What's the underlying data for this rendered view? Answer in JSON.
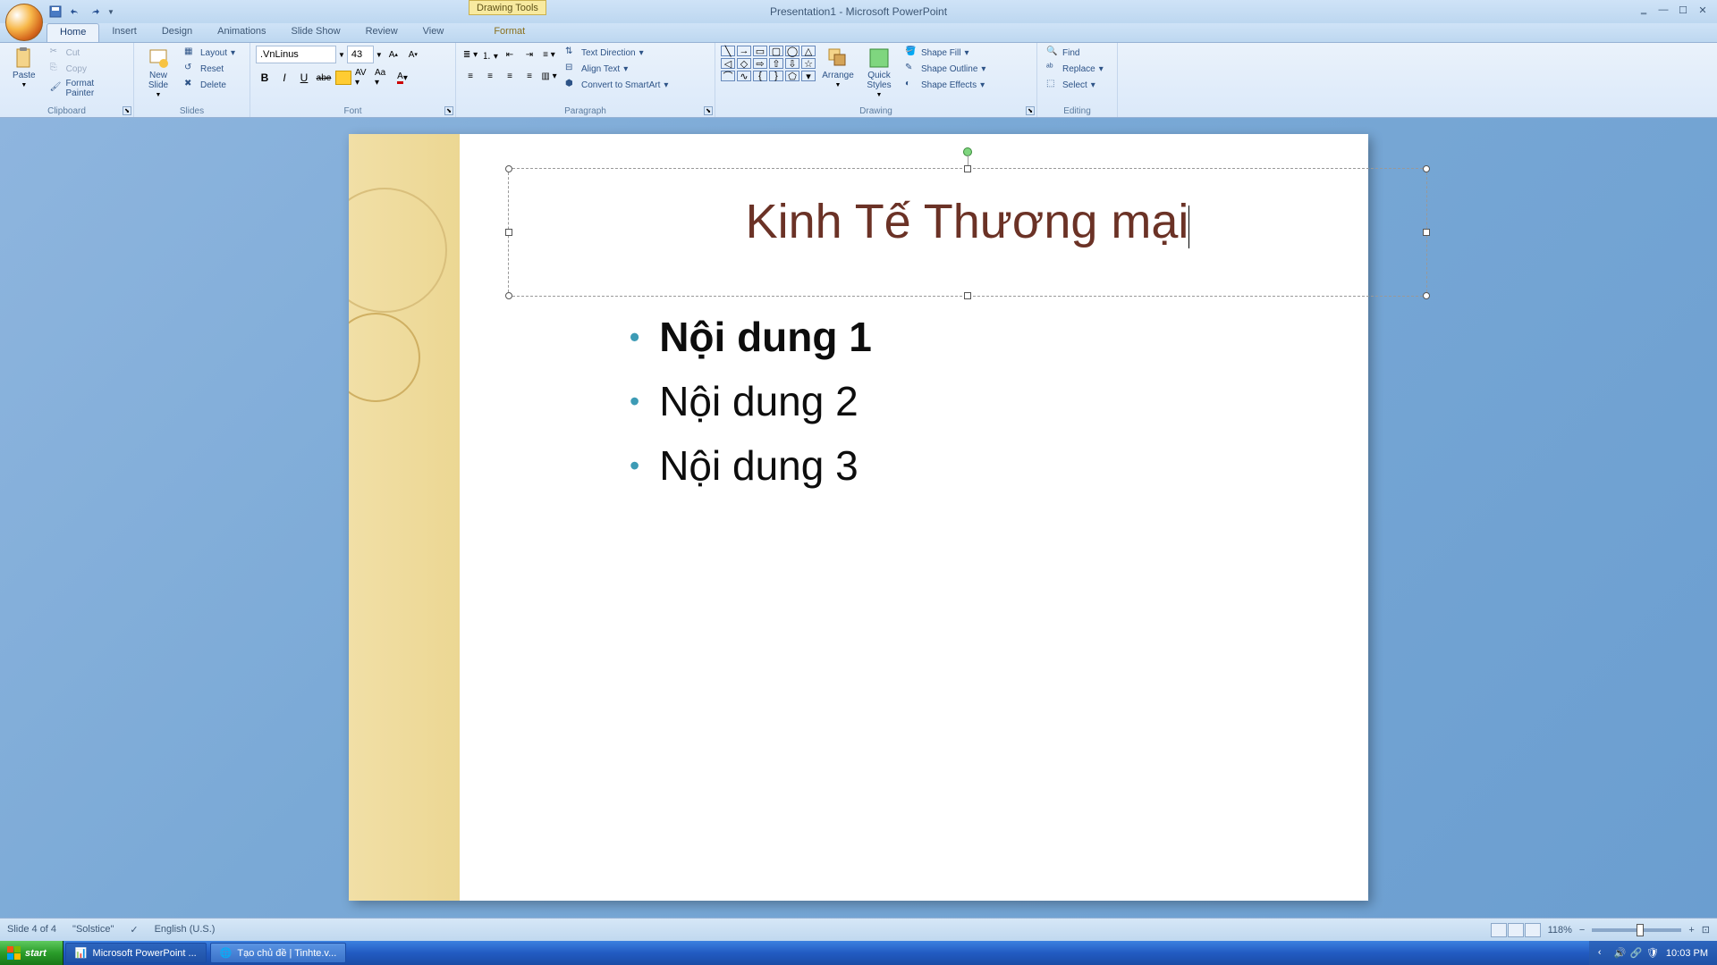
{
  "title_bar": {
    "app_title": "Presentation1 - Microsoft PowerPoint",
    "drawing_tools_label": "Drawing Tools"
  },
  "tabs": {
    "home": "Home",
    "insert": "Insert",
    "design": "Design",
    "animations": "Animations",
    "slideshow": "Slide Show",
    "review": "Review",
    "view": "View",
    "format": "Format"
  },
  "ribbon": {
    "clipboard": {
      "label": "Clipboard",
      "paste": "Paste",
      "cut": "Cut",
      "copy": "Copy",
      "format_painter": "Format Painter"
    },
    "slides": {
      "label": "Slides",
      "new_slide": "New Slide",
      "layout": "Layout",
      "reset": "Reset",
      "delete": "Delete"
    },
    "font": {
      "label": "Font",
      "font_name": ".VnLinus",
      "font_size": "43"
    },
    "paragraph": {
      "label": "Paragraph",
      "text_direction": "Text Direction",
      "align_text": "Align Text",
      "convert_smartart": "Convert to SmartArt"
    },
    "drawing": {
      "label": "Drawing",
      "arrange": "Arrange",
      "quick_styles": "Quick Styles",
      "shape_fill": "Shape Fill",
      "shape_outline": "Shape Outline",
      "shape_effects": "Shape Effects"
    },
    "editing": {
      "label": "Editing",
      "find": "Find",
      "replace": "Replace",
      "select": "Select"
    }
  },
  "slide_content": {
    "title": "Kinh Tế Thương mại",
    "bullets": [
      "Nội dung 1",
      "Nội dung 2",
      "Nội dung 3"
    ]
  },
  "status_bar": {
    "slide_info": "Slide 4 of 4",
    "theme": "\"Solstice\"",
    "language": "English (U.S.)",
    "zoom": "118%"
  },
  "taskbar": {
    "start": "start",
    "items": [
      "Microsoft PowerPoint ...",
      "Tạo chủ đề | Tinhte.v..."
    ],
    "time": "10:03 PM"
  }
}
